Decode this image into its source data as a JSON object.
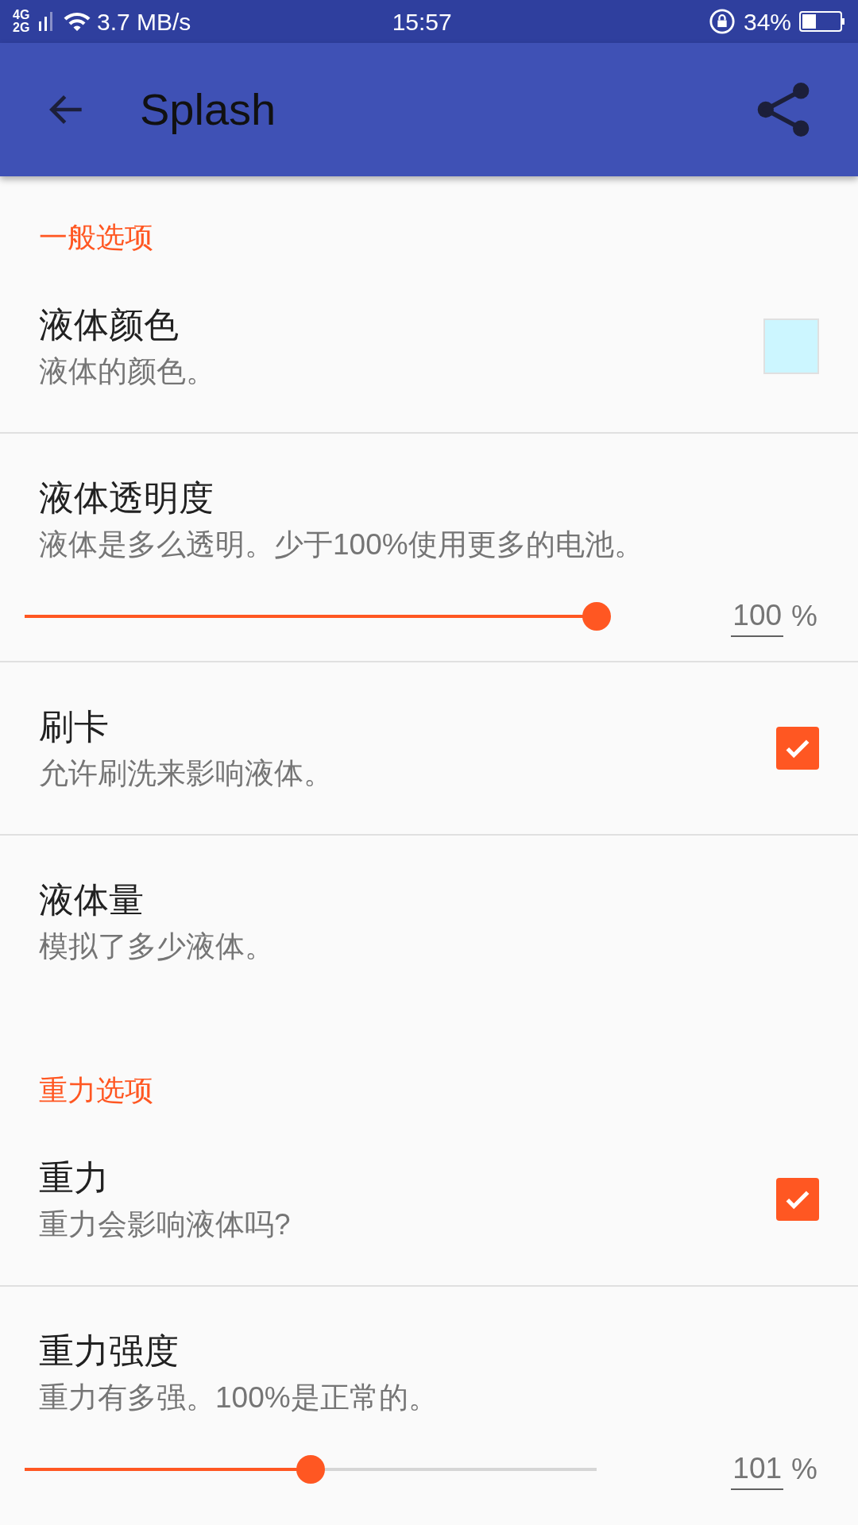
{
  "status_bar": {
    "network": "4G 2G",
    "speed": "3.7 MB/s",
    "time": "15:57",
    "battery": "34%"
  },
  "app_bar": {
    "title": "Splash"
  },
  "sections": [
    {
      "header": "一般选项",
      "items": [
        {
          "kind": "color",
          "title": "液体颜色",
          "summary": "液体的颜色。",
          "color": "#ccf6ff"
        },
        {
          "kind": "slider",
          "title": "液体透明度",
          "summary": "液体是多么透明。少于100%使用更多的电池。",
          "level": 1.0,
          "value": "100",
          "unit": "%"
        },
        {
          "kind": "checkbox",
          "title": "刷卡",
          "summary": "允许刷洗来影响液体。",
          "checked": true
        },
        {
          "kind": "plain",
          "title": "液体量",
          "summary": "模拟了多少液体。"
        }
      ]
    },
    {
      "header": "重力选项",
      "items": [
        {
          "kind": "checkbox",
          "title": "重力",
          "summary": "重力会影响液体吗?",
          "checked": true
        },
        {
          "kind": "slider",
          "title": "重力强度",
          "summary": "重力有多强。100%是正常的。",
          "level": 0.5,
          "value": "101",
          "unit": "%"
        }
      ]
    }
  ]
}
